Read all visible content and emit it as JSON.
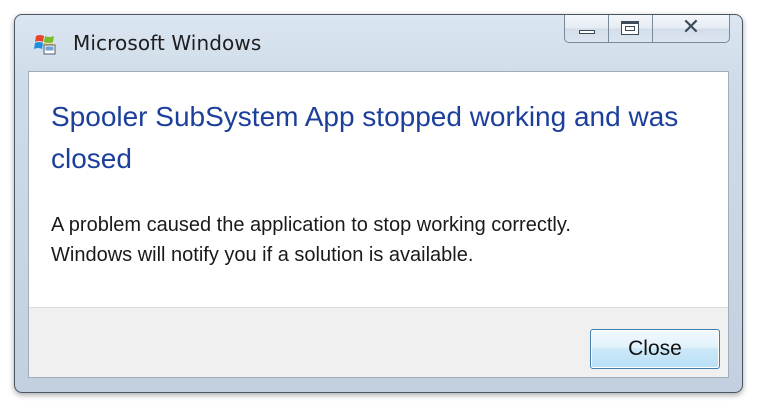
{
  "window": {
    "title": "Microsoft Windows",
    "app_icon": "windows-flag-icon",
    "caption_buttons": {
      "minimize": "minimize-icon",
      "maximize": "maximize-icon",
      "close": "close-icon",
      "close_glyph": "✕"
    }
  },
  "dialog": {
    "main_instruction": "Spooler SubSystem App stopped working and was closed",
    "message_line_1": "A problem caused the application to stop working correctly.",
    "message_line_2": "Windows will notify you if a solution is available.",
    "close_button_label": "Close"
  },
  "colors": {
    "main_instruction": "#1c3f9c",
    "button_border": "#3c7fb1",
    "window_frame": "#c2d0df"
  }
}
